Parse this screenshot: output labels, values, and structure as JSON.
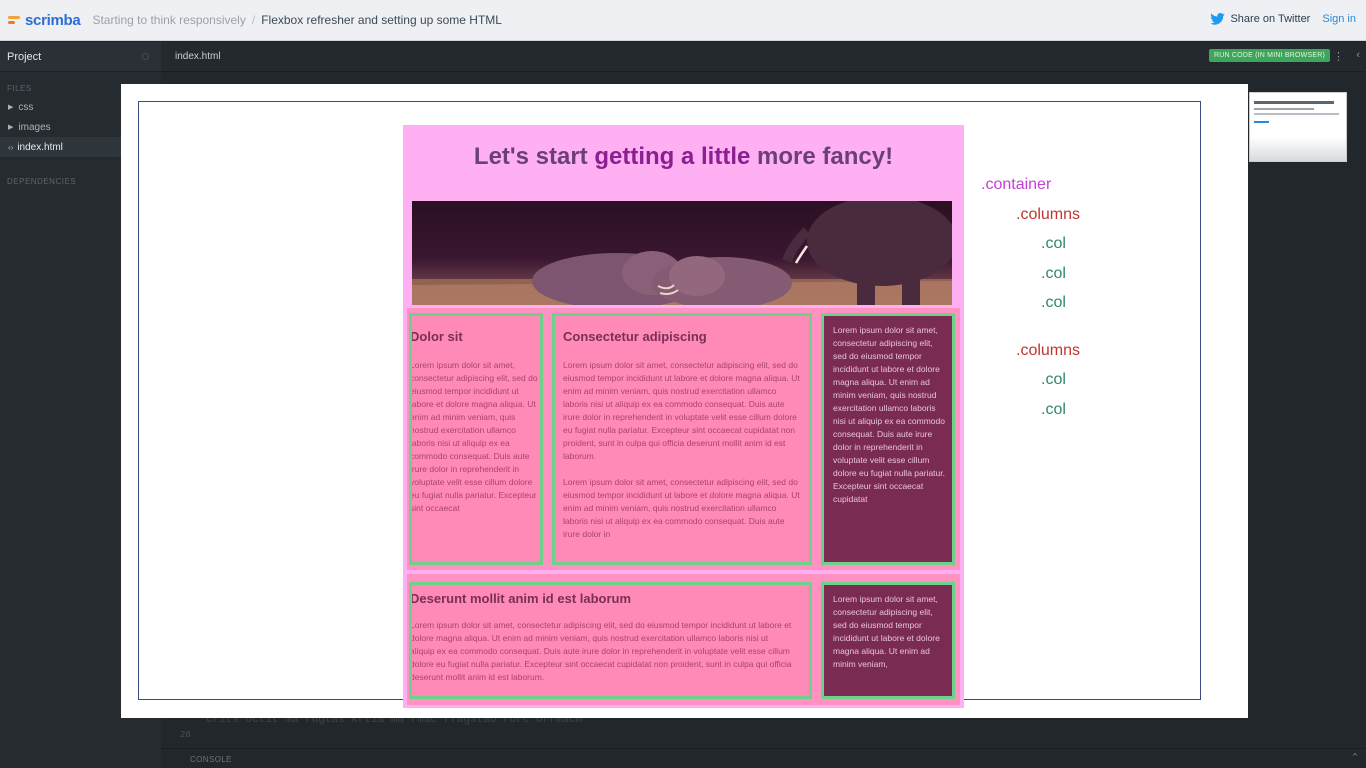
{
  "app": {
    "logo_text": "scrimba",
    "breadcrumb_parent": "Starting to think responsively",
    "breadcrumb_sep": "/",
    "breadcrumb_current": "Flexbox refresher and setting up some HTML",
    "share_label": "Share on Twitter",
    "signin_label": "Sign in"
  },
  "sidebar": {
    "project_label": "Project",
    "files_label": "FILES",
    "files": [
      {
        "label": "css",
        "icon": "folder-arrow"
      },
      {
        "label": "images",
        "icon": "folder-arrow"
      },
      {
        "label": "index.html",
        "icon": "code-icon"
      }
    ],
    "dependencies_label": "DEPENDENCIES"
  },
  "editor": {
    "tab_label": "index.html",
    "run_label": "RUN CODE (IN MINI BROWSER)",
    "ghost_line": "Crits octit ma rugtas krtia ma rmac  rfagstao  rorc orrmacm",
    "line_number": "28",
    "console_label": "CONSOLE"
  },
  "slide": {
    "title_start": "Let's start ",
    "title_highlight": "getting a little",
    "title_end": " more fancy!",
    "row1": {
      "col1": {
        "heading": "Dolor sit",
        "text": "Lorem ipsum dolor sit amet, consectetur adipiscing elit, sed do eiusmod tempor incididunt ut labore et dolore magna aliqua. Ut enim ad minim veniam, quis nostrud exercitation ullamco laboris nisi ut aliquip ex ea commodo consequat. Duis aute irure dolor in reprehenderit in voluptate velit esse cillum dolore eu fugiat nulla pariatur. Excepteur sint occaecat"
      },
      "col2": {
        "heading": "Consectetur adipiscing",
        "text1": "Lorem ipsum dolor sit amet, consectetur adipiscing elit, sed do eiusmod tempor incididunt ut labore et dolore magna aliqua. Ut enim ad minim veniam, quis nostrud exercitation ullamco laboris nisi ut aliquip ex ea commodo consequat. Duis aute irure dolor in reprehenderit in voluptate velit esse cillum dolore eu fugiat nulla pariatur. Excepteur sint occaecat cupidatat non proident, sunt in culpa qui officia deserunt mollit anim id est laborum.",
        "text2": "Lorem ipsum dolor sit amet, consectetur adipiscing elit, sed do eiusmod tempor incididunt ut labore et dolore magna aliqua. Ut enim ad minim veniam, quis nostrud exercitation ullamco laboris nisi ut aliquip ex ea commodo consequat. Duis aute irure dolor in"
      },
      "col3": {
        "text": "Lorem ipsum dolor sit amet, consectetur adipiscing elit, sed do eiusmod tempor incididunt ut labore et dolore magna aliqua. Ut enim ad minim veniam, quis nostrud exercitation ullamco laboris nisi ut aliquip ex ea commodo consequat. Duis aute irure dolor in reprehenderit in voluptate velit esse cillum dolore eu fugiat nulla pariatur. Excepteur sint occaecat cupidatat"
      }
    },
    "row2": {
      "col1": {
        "heading": "Deserunt mollit anim id est laborum",
        "text": "Lorem ipsum dolor sit amet, consectetur adipiscing elit, sed do eiusmod tempor incididunt ut labore et dolore magna aliqua. Ut enim ad minim veniam, quis nostrud exercitation ullamco laboris nisi ut aliquip ex ea commodo consequat. Duis aute irure dolor in reprehenderit in voluptate velit esse cillum dolore eu fugiat nulla pariatur. Excepteur sint occaecat cupidatat non proident, sunt in culpa qui officia deserunt mollit anim id est laborum."
      },
      "col2": {
        "text": "Lorem ipsum dolor sit amet, consectetur adipiscing elit, sed do eiusmod tempor incididunt ut labore et dolore magna aliqua. Ut enim ad minim veniam,"
      }
    },
    "tree": {
      "container": ".container",
      "columns1": ".columns",
      "col1": ".col",
      "col2": ".col",
      "col3": ".col",
      "columns2": ".columns",
      "col4": ".col",
      "col5": ".col"
    }
  },
  "colors": {
    "brand": "#2a6fd1",
    "run_button": "#3ea65a",
    "page_bg": "#ffb0f2",
    "column_border": "#6fd08c"
  }
}
